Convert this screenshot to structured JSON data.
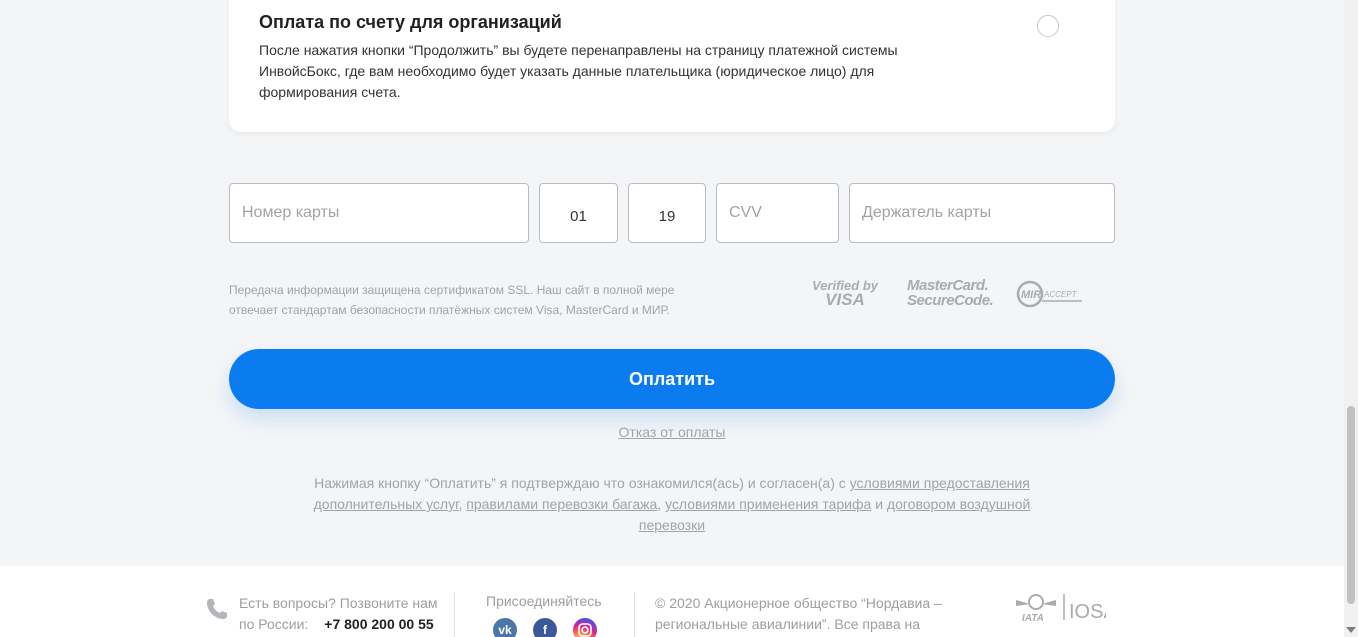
{
  "payment_option": {
    "title": "Оплата по счету для организаций",
    "description": "После нажатия кнопки “Продолжить” вы будете перенаправлены на страницу платежной системы ИнвойсБокс, где вам необходимо будет указать данные плательщика (юридическое лицо) для формирования счета."
  },
  "card_form": {
    "card_number_placeholder": "Номер карты",
    "month_value": "01",
    "year_value": "19",
    "cvv_placeholder": "CVV",
    "holder_placeholder": "Держатель карты"
  },
  "security": {
    "text": "Передача информации защищена сертификатом SSL. Наш сайт в полной мере отвечает стандартам безопасности платёжных систем Visa, MasterCard и МИР.",
    "logos": {
      "visa_line1": "Verified by",
      "visa_line2": "VISA",
      "mc_line1": "MasterCard.",
      "mc_line2": "SecureCode.",
      "mir_logo": "MIR ACCEPT"
    }
  },
  "actions": {
    "pay_label": "Оплатить",
    "cancel_label": "Отказ от оплаты"
  },
  "terms": {
    "prefix": "Нажимая кнопку “Оплатить” я подтверждаю что ознакомился(ась) и согласен(а) с ",
    "link1": "условиями предоставления дополнительных услуг",
    "sep1": ", ",
    "link2": "правилами перевозки багажа",
    "sep2": ", ",
    "link3": "условиями применения тарифа",
    "sep3": " и ",
    "link4": "договором воздушной перевозки"
  },
  "footer": {
    "question": "Есть вопросы? Позвоните нам по России:",
    "phone": "+7 800 200 00 55",
    "join_label": "Присоединяйтесь",
    "social": [
      "vk",
      "f",
      "ig"
    ],
    "copyright": "© 2020 Акционерное общество “Нордавиа – региональные авиалинии”. Все права на",
    "iata_logo": "IATA IOSA"
  },
  "icons": {
    "phone": "phone-icon",
    "radio": "radio-unchecked"
  },
  "colors": {
    "accent": "#0a7cf0",
    "muted_text": "#a0a3a8"
  }
}
